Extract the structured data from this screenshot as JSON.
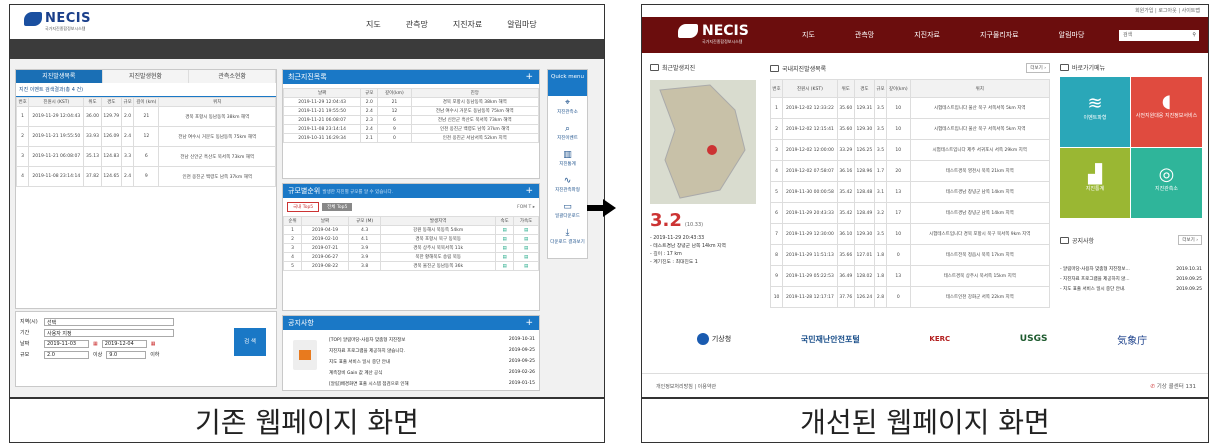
{
  "captions": {
    "before": "기존 웹페이지 화면",
    "after": "개선된 웹페이지 화면"
  },
  "old_site": {
    "logo": "NECIS",
    "logo_sub": "국가지진종합정보시스템",
    "nav": [
      "지도",
      "관측망",
      "지진자료",
      "알림마당"
    ],
    "tabs": [
      "지진발생목록",
      "지진발생현황",
      "관측소현황"
    ],
    "search_result": "지진 이벤트 검색결과(총 4 건)",
    "list_headers": [
      "번호",
      "진원시 (KST)",
      "위도",
      "경도",
      "규모",
      "깊이 (km)",
      "위치"
    ],
    "list_rows": [
      [
        "1",
        "2019-11-29 12:04:43",
        "36.00",
        "129.79",
        "2.0",
        "21",
        "경북 포항시 동남동쪽 38km 해역"
      ],
      [
        "2",
        "2019-11-21 19:55:50",
        "33.93",
        "126.09",
        "2.4",
        "12",
        "전남 여수시 거문도 동남동쪽 75km 해역"
      ],
      [
        "3",
        "2019-11-21 06:08:07",
        "35.13",
        "124.83",
        "3.3",
        "6",
        "전남 신안군 흑산도 북서쪽 73km 해역"
      ],
      [
        "4",
        "2019-11-08 23:14:14",
        "37.82",
        "124.65",
        "2.4",
        "9",
        "인천 옹진군 백령도 남쪽 37km 해역"
      ]
    ],
    "form": {
      "region_label": "지역(시)",
      "region_value": "선택",
      "period_label": "기간",
      "period_value": "사용자 지정",
      "date_label": "날짜",
      "date_from": "2019-11-03",
      "date_to": "2019-12-04",
      "mag_label": "규모",
      "mag_from": "2.0",
      "mag_from_unit": "이상",
      "mag_to": "9.0",
      "mag_to_unit": "이하",
      "search_btn": "검 색"
    },
    "recent_title": "최근지진목록",
    "recent_headers": [
      "날짜",
      "규모",
      "깊이(km)",
      "진앙"
    ],
    "recent_rows": [
      [
        "2019-11-29 12:04:43",
        "2.0",
        "21",
        "경북 포항시 동남동쪽 38km 해역"
      ],
      [
        "2019-11-21 19:55:50",
        "2.4",
        "12",
        "전남 여수시 거문도 동남동쪽 75km 해역"
      ],
      [
        "2019-11-21 06:08:07",
        "2.3",
        "6",
        "전남 신안군 흑산도 북서쪽 73km 해역"
      ],
      [
        "2019-11-08 23:14:14",
        "2.4",
        "9",
        "인천 옹진군 백령도 남쪽 37km 해역"
      ],
      [
        "2019-10-31 16:29:34",
        "2.1",
        "0",
        "인천 옹진군 서남서쪽 52km 지역"
      ]
    ],
    "ranking_title": "규모별순위",
    "ranking_sub": "발생한 지진별 규모를 알 수 있습니다.",
    "ranking_more": "FOM T ▸",
    "ranking_tabs": [
      "국내 Top5",
      "전체 Top5"
    ],
    "ranking_headers": [
      "순위",
      "날짜",
      "규모 (M)",
      "발생지역",
      "속도",
      "가속도"
    ],
    "ranking_rows": [
      [
        "1",
        "2019-04-19",
        "4.3",
        "강원 동해시 북동쪽 54km"
      ],
      [
        "2",
        "2019-02-10",
        "4.1",
        "경북 포항시 북구 동북동"
      ],
      [
        "3",
        "2019-07-21",
        "3.9",
        "경북 상주시 북북서쪽 11k"
      ],
      [
        "4",
        "2019-06-27",
        "3.9",
        "북한 황해북도 송림 북동"
      ],
      [
        "5",
        "2019-08-22",
        "3.8",
        "경북 울진군 동남동쪽 36k"
      ]
    ],
    "notice_title": "공지사항",
    "notices": [
      [
        "[TOP] 알림마당-사용자 맞춤형 지진정보",
        "2019-10-31"
      ],
      [
        "지진자료 프로그램을 제공하지 않습니다.",
        "2019-09-25"
      ],
      [
        "지도 표출 서비스 일시 중단 안내",
        "2019-09-25"
      ],
      [
        "계측장비 Gain 값 계산 공식",
        "2019-02-26"
      ],
      [
        "[알림]배경화면 표출 시스템 점검으로 인해",
        "2019-01-15"
      ]
    ],
    "quick": {
      "title": "Quick menu",
      "items": [
        "지진관측소",
        "지진이벤트",
        "지진통계",
        "지진관측파형",
        "일괄다운로드",
        "다운로드 결과보기"
      ]
    }
  },
  "new_site": {
    "top_links": "회원가입 | 로그아웃 | 사이트맵",
    "logo": "NECIS",
    "logo_sub": "국가지진종합정보시스템",
    "nav": [
      "지도",
      "관측망",
      "지진자료",
      "지구물리자료",
      "알림마당"
    ],
    "search_placeholder": "검색",
    "recent_title": "최근발생지진",
    "recent_mag": "3.2",
    "recent_sub": "(10.33)",
    "recent_info": [
      "- 2019-11-29 20:43:33",
      "- 테스트경남 창녕군 남쪽 14km 지역",
      "- 깊이 : 17 km",
      "- 계기진도 : 최대진도 1"
    ],
    "list_title": "국내지진발생목록",
    "list_more": "더보기 ›",
    "list_headers": [
      "번호",
      "진원시 (KST)",
      "위도",
      "경도",
      "규모",
      "깊이(km)",
      "위치"
    ],
    "list_rows": [
      [
        "1",
        "2019-12-02 12:33:22",
        "35.60",
        "129.31",
        "3.5",
        "10",
        "시험테스트입니다 울산 북구 서쪽서쪽 5km 지역"
      ],
      [
        "2",
        "2019-12-02 12:15:41",
        "35.60",
        "129.30",
        "3.5",
        "10",
        "시험테스트입니다 울산 북구 서쪽서쪽 5km 지역"
      ],
      [
        "3",
        "2019-12-02 12:00:00",
        "33.29",
        "126.25",
        "3.5",
        "10",
        "시험테스트입니다 제주 서귀포시 서쪽 29km 지역"
      ],
      [
        "4",
        "2019-12-02 07:58:07",
        "36.16",
        "128.96",
        "1.7",
        "20",
        "테스트경북 영천시 북쪽 21km 지역"
      ],
      [
        "5",
        "2019-11-30 00:00:58",
        "35.42",
        "128.48",
        "3.1",
        "13",
        "테스트경남 창녕군 남쪽 14km 지역"
      ],
      [
        "6",
        "2019-11-29 20:43:33",
        "35.42",
        "128.49",
        "3.2",
        "17",
        "테스트경남 창녕군 남쪽 14km 지역"
      ],
      [
        "7",
        "2019-11-29 12:30:00",
        "36.10",
        "129.30",
        "3.5",
        "10",
        "시험테스트입니다 경북 포항시 북구 북서쪽 9km 지역"
      ],
      [
        "8",
        "2019-11-29 11:51:13",
        "35.66",
        "127.01",
        "1.8",
        "0",
        "테스트전북 정읍시 북쪽 17km 지역"
      ],
      [
        "9",
        "2019-11-29 05:22:53",
        "36.49",
        "128.02",
        "1.8",
        "13",
        "테스트경북 상주시 북서쪽 15km 지역"
      ],
      [
        "10",
        "2019-11-28 12:17:17",
        "37.76",
        "126.24",
        "2.8",
        "0",
        "테스트인천 강화군 서쪽 22km 지역"
      ]
    ],
    "shortcut_title": "바로가기메뉴",
    "tiles": [
      "이벤트파형",
      "사전지원대응 지진정보서비스",
      "지진통계",
      "지진관측소"
    ],
    "notice_title": "공지사항",
    "notice_more": "더보기 ›",
    "notices": [
      [
        "- 알림마당-사용자 맞춤형 지진정보...",
        "2019.10.31"
      ],
      [
        "- 지진자료 프로그램을 제공하지 않...",
        "2019.09.25"
      ],
      [
        "- 지도 표출 서비스 일시 중단 안내.",
        "2019.09.25"
      ]
    ],
    "partners": [
      "기상청",
      "국민재난안전포털",
      "KERC",
      "USGS",
      "気象庁"
    ],
    "footer_left": "개인정보처리방침 | 이용약관",
    "footer_right": "기상 콜센터 131"
  }
}
